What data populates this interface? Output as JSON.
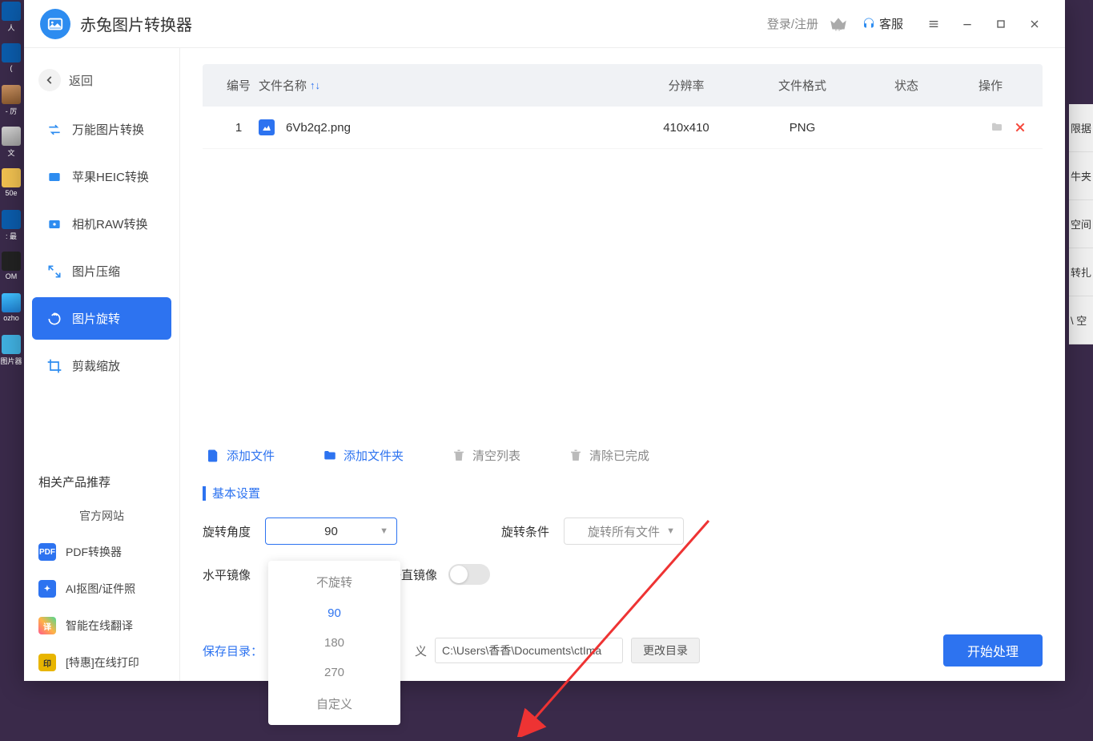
{
  "app": {
    "title": "赤兔图片转换器"
  },
  "titlebar": {
    "login_register": "登录/注册",
    "customer_service": "客服"
  },
  "sidebar": {
    "back": "返回",
    "items": [
      {
        "label": "万能图片转换"
      },
      {
        "label": "苹果HEIC转换"
      },
      {
        "label": "相机RAW转换"
      },
      {
        "label": "图片压缩"
      },
      {
        "label": "图片旋转"
      },
      {
        "label": "剪裁缩放"
      }
    ],
    "related_title": "相关产品推荐",
    "official_site": "官方网站",
    "related": [
      {
        "badge": "PDF",
        "label": "PDF转换器"
      },
      {
        "badge": "✦",
        "label": "AI抠图/证件照"
      },
      {
        "badge": "译",
        "label": "智能在线翻译"
      },
      {
        "badge": "印",
        "label": "[特惠]在线打印"
      }
    ]
  },
  "table": {
    "headers": {
      "num": "编号",
      "name": "文件名称",
      "res": "分辨率",
      "fmt": "文件格式",
      "status": "状态",
      "act": "操作"
    },
    "rows": [
      {
        "num": "1",
        "name": "6Vb2q2.png",
        "res": "410x410",
        "fmt": "PNG",
        "status": ""
      }
    ]
  },
  "toolbar": {
    "add_file": "添加文件",
    "add_folder": "添加文件夹",
    "clear_list": "清空列表",
    "clear_done": "清除已完成"
  },
  "settings": {
    "section_title": "基本设置",
    "rotate_angle_label": "旋转角度",
    "rotate_angle_value": "90",
    "rotate_condition_label": "旋转条件",
    "rotate_condition_value": "旋转所有文件",
    "h_mirror_label": "水平镜像",
    "v_mirror_label": "垂直镜像",
    "dropdown_options": [
      "不旋转",
      "90",
      "180",
      "270",
      "自定义"
    ]
  },
  "save": {
    "label": "保存目录：",
    "custom_seg": "义",
    "path": "C:\\Users\\香香\\Documents\\ctIma",
    "change_dir": "更改目录",
    "start": "开始处理"
  },
  "desktop_partial": [
    "限据",
    "牛夹",
    "空间",
    "转扎",
    "\\ 空"
  ]
}
